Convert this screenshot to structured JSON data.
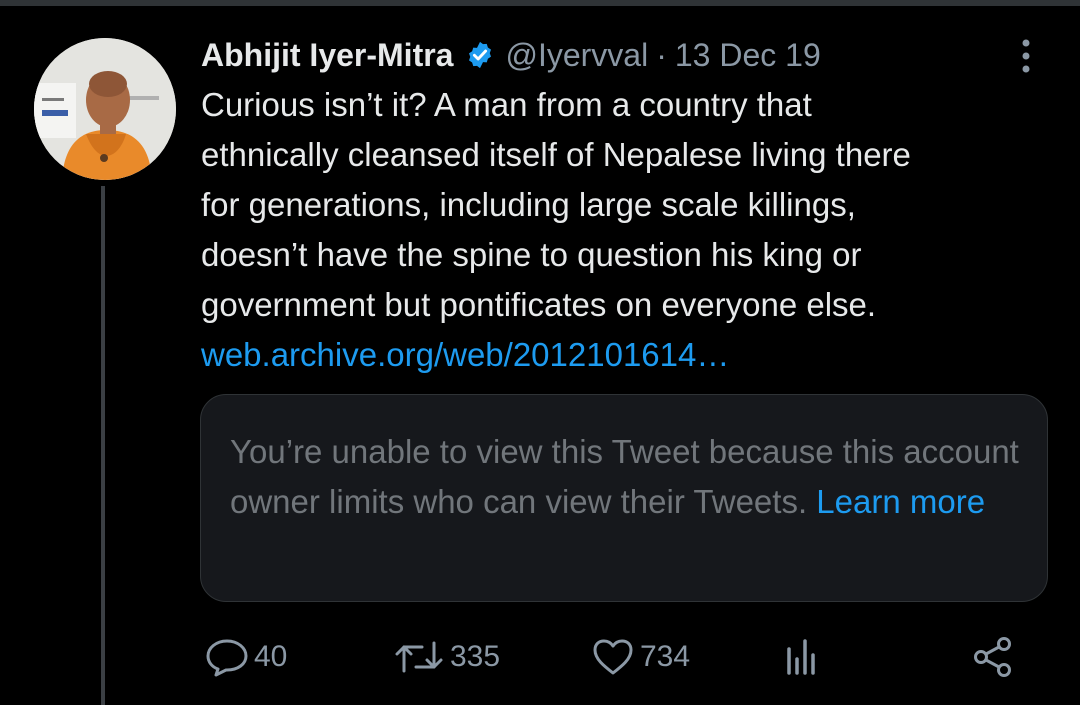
{
  "tweet": {
    "author_name": "Abhijit Iyer-Mitra",
    "handle": "@Iyervval",
    "separator": "·",
    "date": "13 Dec 19",
    "text": "Curious isn’t it? A man from a country that\nethnically cleansed itself of Nepalese living there\nfor generations, including large scale killings,\ndoesn’t have the spine to question his king or\ngovernment but pontificates on everyone else.",
    "link": "web.archive.org/web/2012101614…"
  },
  "quoted": {
    "message": "You’re unable to view this Tweet because this account owner limits who can view their Tweets.",
    "learn_more": "Learn more"
  },
  "actions": {
    "replies": "40",
    "retweets": "335",
    "likes": "734"
  },
  "icons": {
    "verified": "verified-badge-icon",
    "more": "more-vertical-icon",
    "reply": "reply-icon",
    "retweet": "retweet-icon",
    "like": "heart-icon",
    "views": "analytics-icon",
    "share": "share-icon"
  },
  "colors": {
    "background": "#000000",
    "text": "#e7e9ea",
    "secondary": "#8b98a5",
    "accent": "#1d9bf0",
    "card_bg": "#16181c"
  }
}
